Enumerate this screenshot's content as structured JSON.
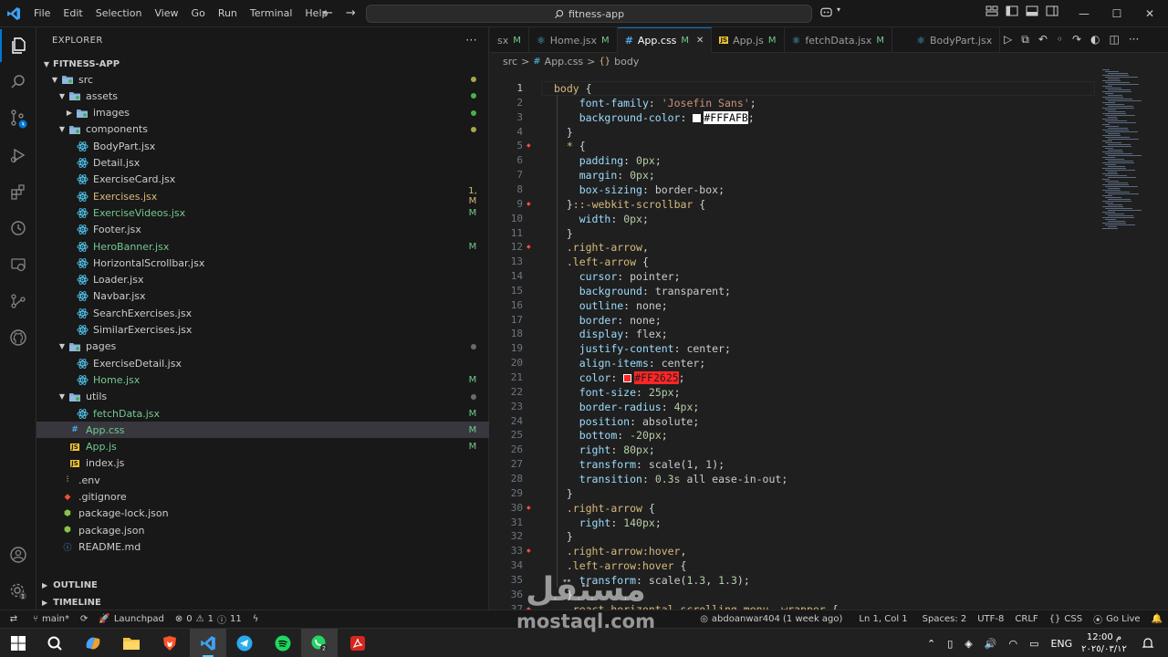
{
  "titlebar": {
    "menu": [
      "File",
      "Edit",
      "Selection",
      "View",
      "Go",
      "Run",
      "Terminal",
      "Help"
    ],
    "search": "fitness-app"
  },
  "explorer": {
    "header": "EXPLORER",
    "more": "···",
    "project": "FITNESS-APP",
    "rows": [
      {
        "name": "src",
        "type": "folder",
        "depth": 1,
        "open": true,
        "status": "dot-olive"
      },
      {
        "name": "assets",
        "type": "folder",
        "depth": 2,
        "open": true,
        "status": "dot-green"
      },
      {
        "name": "images",
        "type": "folder",
        "depth": 3,
        "open": false,
        "status": "dot-green"
      },
      {
        "name": "components",
        "type": "folder",
        "depth": 2,
        "open": true,
        "status": "dot-olive"
      },
      {
        "name": "BodyPart.jsx",
        "type": "react",
        "depth": 3,
        "status": ""
      },
      {
        "name": "Detail.jsx",
        "type": "react",
        "depth": 3,
        "status": ""
      },
      {
        "name": "ExerciseCard.jsx",
        "type": "react",
        "depth": 3,
        "status": ""
      },
      {
        "name": "Exercises.jsx",
        "type": "react",
        "depth": 3,
        "status": "1, M",
        "color": "#d7ba7d"
      },
      {
        "name": "ExerciseVideos.jsx",
        "type": "react",
        "depth": 3,
        "status": "M",
        "color": "#73c991"
      },
      {
        "name": "Footer.jsx",
        "type": "react",
        "depth": 3,
        "status": ""
      },
      {
        "name": "HeroBanner.jsx",
        "type": "react",
        "depth": 3,
        "status": "M",
        "color": "#73c991"
      },
      {
        "name": "HorizontalScrollbar.jsx",
        "type": "react",
        "depth": 3,
        "status": ""
      },
      {
        "name": "Loader.jsx",
        "type": "react",
        "depth": 3,
        "status": ""
      },
      {
        "name": "Navbar.jsx",
        "type": "react",
        "depth": 3,
        "status": ""
      },
      {
        "name": "SearchExercises.jsx",
        "type": "react",
        "depth": 3,
        "status": ""
      },
      {
        "name": "SimilarExercises.jsx",
        "type": "react",
        "depth": 3,
        "status": ""
      },
      {
        "name": "pages",
        "type": "folder",
        "depth": 2,
        "open": true,
        "status": "dot-grey"
      },
      {
        "name": "ExerciseDetail.jsx",
        "type": "react",
        "depth": 3,
        "status": ""
      },
      {
        "name": "Home.jsx",
        "type": "react",
        "depth": 3,
        "status": "M",
        "color": "#73c991"
      },
      {
        "name": "utils",
        "type": "folder",
        "depth": 2,
        "open": true,
        "status": "dot-grey"
      },
      {
        "name": "fetchData.jsx",
        "type": "react",
        "depth": 3,
        "status": "M",
        "color": "#73c991"
      },
      {
        "name": "App.css",
        "type": "css",
        "depth": 2,
        "status": "M",
        "color": "#73c991",
        "selected": true
      },
      {
        "name": "App.js",
        "type": "js",
        "depth": 2,
        "status": "M",
        "color": "#73c991"
      },
      {
        "name": "index.js",
        "type": "js",
        "depth": 2,
        "status": ""
      },
      {
        "name": ".env",
        "type": "env",
        "depth": 1,
        "status": ""
      },
      {
        "name": ".gitignore",
        "type": "git",
        "depth": 1,
        "status": ""
      },
      {
        "name": "package-lock.json",
        "type": "npm",
        "depth": 1,
        "status": ""
      },
      {
        "name": "package.json",
        "type": "npm",
        "depth": 1,
        "status": ""
      },
      {
        "name": "README.md",
        "type": "info",
        "depth": 1,
        "status": ""
      }
    ],
    "outline": "OUTLINE",
    "timeline": "TIMELINE"
  },
  "tabs": [
    {
      "name": "sx",
      "mod": "M",
      "partial": true
    },
    {
      "name": "Home.jsx",
      "mod": "M",
      "type": "react"
    },
    {
      "name": "App.css",
      "mod": "M",
      "type": "css",
      "active": true
    },
    {
      "name": "App.js",
      "mod": "M",
      "type": "js"
    },
    {
      "name": "fetchData.jsx",
      "mod": "M",
      "type": "react"
    },
    {
      "name": "BodyPart.jsx",
      "mod": "",
      "type": "react"
    }
  ],
  "breadcrumb": {
    "a": "src",
    "sep": ">",
    "b": "App.css",
    "c": "body"
  },
  "code_lines": [
    {
      "n": "1",
      "html": "<span class=\"k-sel\">body</span> <span class=\"k-punc\">{</span>"
    },
    {
      "n": "2",
      "html": "    <span class=\"k-prop\">font-family</span><span class=\"k-punc\">:</span> <span class=\"k-val\">'Josefin Sans'</span><span class=\"k-punc\">;</span>"
    },
    {
      "n": "3",
      "html": "    <span class=\"k-prop\">background-color</span><span class=\"k-punc\">:</span> <span class=\"swatch\" style=\"background:#FFFAFB\"></span><span class=\"hl-white\">#FFFAFB</span><span class=\"k-punc\">;</span>"
    },
    {
      "n": "4",
      "html": "  <span class=\"k-punc\">}</span>"
    },
    {
      "n": "5",
      "html": "  <span class=\"k-sel\">*</span> <span class=\"k-punc\">{</span>"
    },
    {
      "n": "6",
      "html": "    <span class=\"k-prop\">padding</span><span class=\"k-punc\">:</span> <span class=\"k-num\">0px</span><span class=\"k-punc\">;</span>"
    },
    {
      "n": "7",
      "html": "    <span class=\"k-prop\">margin</span><span class=\"k-punc\">:</span> <span class=\"k-num\">0px</span><span class=\"k-punc\">;</span>"
    },
    {
      "n": "8",
      "html": "    <span class=\"k-prop\">box-sizing</span><span class=\"k-punc\">:</span> <span class=\"k-ident\">border-box</span><span class=\"k-punc\">;</span>"
    },
    {
      "n": "9",
      "html": "  <span class=\"k-punc\">}</span><span class=\"k-sel\">::-webkit-scrollbar</span> <span class=\"k-punc\">{</span>"
    },
    {
      "n": "10",
      "html": "    <span class=\"k-prop\">width</span><span class=\"k-punc\">:</span> <span class=\"k-num\">0px</span><span class=\"k-punc\">;</span>"
    },
    {
      "n": "11",
      "html": "  <span class=\"k-punc\">}</span>"
    },
    {
      "n": "12",
      "html": "  <span class=\"k-sel\">.right-arrow</span><span class=\"k-punc\">,</span>"
    },
    {
      "n": "13",
      "html": "  <span class=\"k-sel\">.left-arrow</span> <span class=\"k-punc\">{</span>"
    },
    {
      "n": "14",
      "html": "    <span class=\"k-prop\">cursor</span><span class=\"k-punc\">:</span> <span class=\"k-ident\">pointer</span><span class=\"k-punc\">;</span>"
    },
    {
      "n": "15",
      "html": "    <span class=\"k-prop\">background</span><span class=\"k-punc\">:</span> <span class=\"k-ident\">transparent</span><span class=\"k-punc\">;</span>"
    },
    {
      "n": "16",
      "html": "    <span class=\"k-prop\">outline</span><span class=\"k-punc\">:</span> <span class=\"k-ident\">none</span><span class=\"k-punc\">;</span>"
    },
    {
      "n": "17",
      "html": "    <span class=\"k-prop\">border</span><span class=\"k-punc\">:</span> <span class=\"k-ident\">none</span><span class=\"k-punc\">;</span>"
    },
    {
      "n": "18",
      "html": "    <span class=\"k-prop\">display</span><span class=\"k-punc\">:</span> <span class=\"k-ident\">flex</span><span class=\"k-punc\">;</span>"
    },
    {
      "n": "19",
      "html": "    <span class=\"k-prop\">justify-content</span><span class=\"k-punc\">:</span> <span class=\"k-ident\">center</span><span class=\"k-punc\">;</span>"
    },
    {
      "n": "20",
      "html": "    <span class=\"k-prop\">align-items</span><span class=\"k-punc\">:</span> <span class=\"k-ident\">center</span><span class=\"k-punc\">;</span>"
    },
    {
      "n": "21",
      "html": "    <span class=\"k-prop\">color</span><span class=\"k-punc\">:</span> <span class=\"swatch\" style=\"background:#FF2625\"></span><span class=\"hl-red\">#FF2625</span><span class=\"k-punc\">;</span>"
    },
    {
      "n": "22",
      "html": "    <span class=\"k-prop\">font-size</span><span class=\"k-punc\">:</span> <span class=\"k-num\">25px</span><span class=\"k-punc\">;</span>"
    },
    {
      "n": "23",
      "html": "    <span class=\"k-prop\">border-radius</span><span class=\"k-punc\">:</span> <span class=\"k-num\">4px</span><span class=\"k-punc\">;</span>"
    },
    {
      "n": "24",
      "html": "    <span class=\"k-prop\">position</span><span class=\"k-punc\">:</span> <span class=\"k-ident\">absolute</span><span class=\"k-punc\">;</span>"
    },
    {
      "n": "25",
      "html": "    <span class=\"k-prop\">bottom</span><span class=\"k-punc\">:</span> <span class=\"k-num\">-20px</span><span class=\"k-punc\">;</span>"
    },
    {
      "n": "26",
      "html": "    <span class=\"k-prop\">right</span><span class=\"k-punc\">:</span> <span class=\"k-num\">80px</span><span class=\"k-punc\">;</span>"
    },
    {
      "n": "27",
      "html": "    <span class=\"k-prop\">transform</span><span class=\"k-punc\">:</span> <span class=\"k-ident\">scale</span><span class=\"k-punc\">(</span><span class=\"k-num\">1</span><span class=\"k-punc\">,</span> <span class=\"k-num\">1</span><span class=\"k-punc\">);</span>"
    },
    {
      "n": "28",
      "html": "    <span class=\"k-prop\">transition</span><span class=\"k-punc\">:</span> <span class=\"k-num\">0.3s</span> <span class=\"k-ident\">all ease-in-out</span><span class=\"k-punc\">;</span>"
    },
    {
      "n": "29",
      "html": "  <span class=\"k-punc\">}</span>"
    },
    {
      "n": "30",
      "html": "  <span class=\"k-sel\">.right-arrow</span> <span class=\"k-punc\">{</span>"
    },
    {
      "n": "31",
      "html": "    <span class=\"k-prop\">right</span><span class=\"k-punc\">:</span> <span class=\"k-num\">140px</span><span class=\"k-punc\">;</span>"
    },
    {
      "n": "32",
      "html": "  <span class=\"k-punc\">}</span>"
    },
    {
      "n": "33",
      "html": "  <span class=\"k-sel\">.right-arrow:hover</span><span class=\"k-punc\">,</span>"
    },
    {
      "n": "34",
      "html": "  <span class=\"k-sel\">.left-arrow:hover</span> <span class=\"k-punc\">{</span>"
    },
    {
      "n": "35",
      "html": "    <span class=\"k-prop\">transform</span><span class=\"k-punc\">:</span> <span class=\"k-ident\">scale</span><span class=\"k-punc\">(</span><span class=\"k-num\">1.3</span><span class=\"k-punc\">,</span> <span class=\"k-num\">1.3</span><span class=\"k-punc\">);</span>"
    },
    {
      "n": "36",
      "html": "  <span class=\"k-punc\">}</span>"
    },
    {
      "n": "37",
      "html": "  <span class=\"k-sel\">.react-horizontal-scrolling-menu--wrapper</span> <span class=\"k-punc\">{</span>"
    }
  ],
  "statusbar": {
    "branch": "main*",
    "launchpad": "Launchpad",
    "errors": "0",
    "warnings": "1",
    "info": "11",
    "blame": "abdoanwar404 (1 week ago)",
    "position": "Ln 1, Col 1",
    "spaces": "Spaces: 2",
    "encoding": "UTF-8",
    "eol": "CRLF",
    "language": "CSS",
    "golive": "Go Live"
  },
  "taskbar": {
    "lang": "ENG",
    "time": "12:00 م",
    "date": "٢٠٢٥/٠٣/١٢"
  },
  "watermark": {
    "ar": "مستقل",
    "en": "mostaql.com"
  },
  "colors": {
    "accent": "#0078d4",
    "modified": "#73c991",
    "warning": "#d7ba7d",
    "react": "#4fc1e9",
    "js": "#f0c430"
  }
}
